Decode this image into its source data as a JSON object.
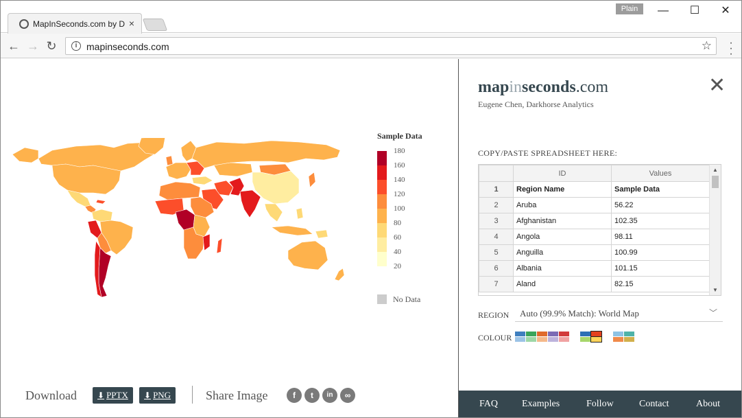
{
  "browser": {
    "tab_title": "MapInSeconds.com by D",
    "tab_close": "×",
    "profile_badge": "Plain",
    "window_controls": {
      "minimize": "—",
      "maximize": "☐",
      "close": "✕"
    },
    "url": "mapinseconds.com"
  },
  "legend": {
    "title": "Sample Data",
    "ticks": [
      "180",
      "160",
      "140",
      "120",
      "100",
      "80",
      "60",
      "40",
      "20"
    ],
    "colors": [
      "#b10026",
      "#e31a1c",
      "#fc4e2a",
      "#fd8d3c",
      "#feb24c",
      "#fed976",
      "#ffeda0",
      "#ffffcc"
    ],
    "no_data_label": "No Data",
    "no_data_color": "#cccccc"
  },
  "download": {
    "label": "Download",
    "pptx": "PPTX",
    "png": "PNG",
    "share_label": "Share Image",
    "social": [
      "f",
      "t",
      "in",
      "∞"
    ]
  },
  "side": {
    "brand_parts": [
      "map",
      "in",
      "seconds",
      ".com"
    ],
    "author": "Eugene Chen, Darkhorse Analytics",
    "paste_label": "COPY/PASTE SPREADSHEET HERE:",
    "sheet": {
      "columns": [
        "ID",
        "Values"
      ],
      "rows": [
        [
          "1",
          "Region Name",
          "Sample Data"
        ],
        [
          "2",
          "Aruba",
          "56.22"
        ],
        [
          "3",
          "Afghanistan",
          "102.35"
        ],
        [
          "4",
          "Angola",
          "98.11"
        ],
        [
          "5",
          "Anguilla",
          "100.99"
        ],
        [
          "6",
          "Albania",
          "101.15"
        ],
        [
          "7",
          "Aland",
          "82.15"
        ]
      ]
    },
    "region_label": "REGION",
    "region_value": "Auto (99.9% Match): World Map",
    "colour_label": "COLOUR",
    "footer": [
      "FAQ",
      "Examples",
      "Follow",
      "Contact",
      "About"
    ]
  },
  "chart_data": {
    "type": "heatmap",
    "title": "Sample Data",
    "scale": [
      20,
      180
    ],
    "ticks": [
      180,
      160,
      140,
      120,
      100,
      80,
      60,
      40,
      20
    ],
    "values": [
      {
        "region": "Aruba",
        "value": 56.22
      },
      {
        "region": "Afghanistan",
        "value": 102.35
      },
      {
        "region": "Angola",
        "value": 98.11
      },
      {
        "region": "Anguilla",
        "value": 100.99
      },
      {
        "region": "Albania",
        "value": 101.15
      },
      {
        "region": "Aland",
        "value": 82.15
      }
    ]
  }
}
